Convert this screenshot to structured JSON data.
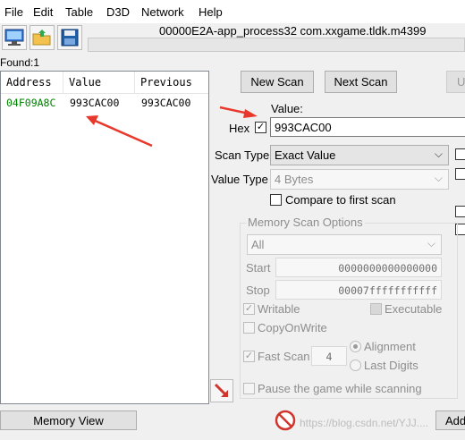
{
  "menu": [
    "File",
    "Edit",
    "Table",
    "D3D",
    "Network",
    "Help"
  ],
  "window_title": "00000E2A-app_process32 com.xxgame.tldk.m4399",
  "found_label": "Found:1",
  "columns": [
    "Address",
    "Value",
    "Previous"
  ],
  "result": {
    "address": "04F09A8C",
    "value": "993CAC00",
    "previous": "993CAC00"
  },
  "buttons": {
    "new_scan": "New Scan",
    "next_scan": "Next Scan",
    "undo": "U",
    "memory_view": "Memory View",
    "add": "Add"
  },
  "value_label": "Value:",
  "hex_label": "Hex",
  "hex_checked": "✓",
  "value_input": "993CAC00",
  "scan_type": {
    "label": "Scan Type",
    "value": "Exact Value"
  },
  "value_type": {
    "label": "Value Type",
    "value": "4 Bytes"
  },
  "compare_first": "Compare to first scan",
  "memory_options": {
    "title": "Memory Scan Options",
    "region": "All",
    "start_label": "Start",
    "start_value": "0000000000000000",
    "stop_label": "Stop",
    "stop_value": "00007fffffffffff",
    "writable": "Writable",
    "executable": "Executable",
    "copy_on_write": "CopyOnWrite",
    "fast_scan": "Fast Scan",
    "fast_scan_value": "4",
    "alignment": "Alignment",
    "last_digits": "Last Digits",
    "check": "✓"
  },
  "pause_label": "Pause the game while scanning",
  "watermark": "https://blog.csdn.net/YJJ....",
  "colors": {
    "address": "#008000",
    "arrow": "#e8372b"
  }
}
